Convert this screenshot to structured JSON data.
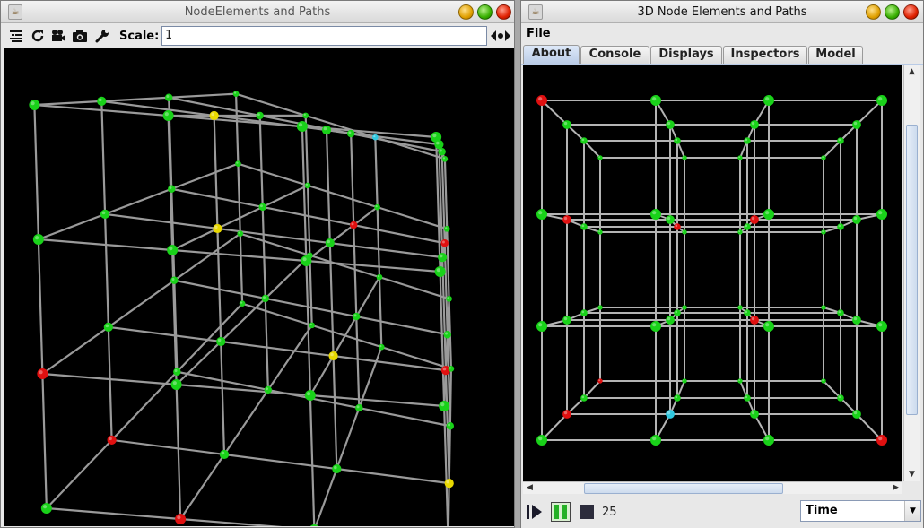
{
  "left_window": {
    "title": "NodeElements and Paths",
    "toolbar": {
      "icons": [
        "list-icon",
        "refresh-icon",
        "camera-video-icon",
        "camera-icon",
        "wrench-icon"
      ],
      "scale_label": "Scale:",
      "scale_value": "1",
      "arrows_icon": "arrows-icon"
    }
  },
  "right_window": {
    "title": "3D Node Elements and Paths",
    "menu": [
      "File"
    ],
    "tabs": [
      {
        "label": "About",
        "active": true
      },
      {
        "label": "Console",
        "active": false
      },
      {
        "label": "Displays",
        "active": false
      },
      {
        "label": "Inspectors",
        "active": false
      },
      {
        "label": "Model",
        "active": false
      }
    ],
    "controls": {
      "step_count": "25",
      "time_select": "Time"
    }
  },
  "colors": {
    "node_green": "#19d219",
    "node_red": "#e01010",
    "node_yellow": "#e8d800",
    "node_cyan": "#30c8e0",
    "edge_gray": "#9a9a9a"
  }
}
